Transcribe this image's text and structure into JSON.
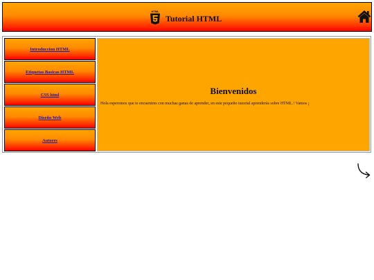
{
  "header": {
    "title": "Tutorial HTML",
    "logo_icon": "html5-icon",
    "home_icon": "home-icon"
  },
  "nav": {
    "items": [
      {
        "label": "Introduccion HTML"
      },
      {
        "label": "Etiquetas Basicas HTML"
      },
      {
        "label": "CSS html"
      },
      {
        "label": "Diseño Web"
      },
      {
        "label": "Autores"
      }
    ]
  },
  "content": {
    "title": "Bienvenidos",
    "text": "Hola esperemos que te encuentres con muchas ganas de aprender, en este pequeño tutorial aprenderás sobre HTML.! Vamos ¡"
  },
  "next_icon": "curved-arrow-right-icon",
  "colors": {
    "gradient_top": "#ffa500",
    "gradient_bottom": "#ff0000",
    "content_bg": "#ffa500",
    "link": "#1a1aaa"
  }
}
